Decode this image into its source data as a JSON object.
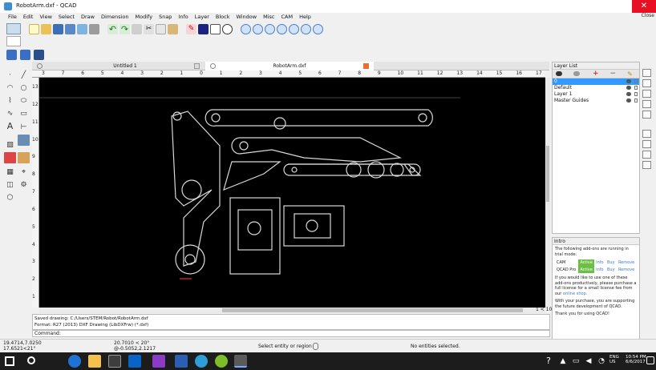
{
  "window": {
    "title": "RobotArm.dxf - QCAD",
    "close_label": "Close"
  },
  "menu": [
    "File",
    "Edit",
    "View",
    "Select",
    "Draw",
    "Dimension",
    "Modify",
    "Snap",
    "Info",
    "Layer",
    "Block",
    "Window",
    "Misc",
    "CAM",
    "Help"
  ],
  "tabs": [
    {
      "label": "Untitled 1"
    },
    {
      "label": "RobotArm.dxf"
    }
  ],
  "ruler_top": [
    "3",
    "7",
    "6",
    "5",
    "4",
    "3",
    "2",
    "1",
    "0",
    "1",
    "2",
    "3",
    "4",
    "5",
    "6",
    "7",
    "8",
    "9",
    "10",
    "11",
    "12",
    "13",
    "14",
    "15",
    "16",
    "17"
  ],
  "ruler_left": [
    "13",
    "12",
    "11",
    "10",
    "9",
    "8",
    "7",
    "6",
    "5",
    "4",
    "3",
    "2",
    "1"
  ],
  "scroll_label": "1 < 10",
  "command_history": [
    "Saved drawing: C:/Users/STEM/Robot/RobotArm.dxf",
    "Format: R27 (2013) DXF Drawing (LibDXFrw) (*.dxf)"
  ],
  "command_prompt": "Command:",
  "layer_panel": {
    "title": "Layer List",
    "layers": [
      {
        "name": "0",
        "selected": true
      },
      {
        "name": "Default",
        "selected": false
      },
      {
        "name": "Layer 1",
        "selected": false
      },
      {
        "name": "Master Guides",
        "selected": false
      }
    ]
  },
  "intro_panel": {
    "title": "Intro",
    "lead": "The following add-ons are running in trial mode:",
    "addons": [
      {
        "name": "CAM",
        "status": "Active",
        "c2": "Info",
        "c3": "Buy",
        "c4": "Remove"
      },
      {
        "name": "QCAD Pro",
        "status": "Active",
        "c2": "Info",
        "c3": "Buy",
        "c4": "Remove"
      }
    ],
    "para1": "If you would like to use one of these add-ons productively, please purchase a full license for a small license fee from our",
    "shop_link": "online shop.",
    "para2": "With your purchase, you are supporting the future development of QCAD.",
    "thanks": "Thank you for using QCAD!"
  },
  "status": {
    "coord_abs": "19.4714,7.0250",
    "coord_abs2": "17.6521<21°",
    "coord_rel": "20.7010 < 20°",
    "coord_rel2": "@-0.5052,2.1217",
    "hint": "Select entity or region",
    "selection": "No entities selected."
  },
  "taskbar": {
    "lang": "ENG",
    "region": "US",
    "time": "10:54 PM",
    "date": "6/6/2017"
  },
  "colors": {
    "canvas": "#000000",
    "accent_active": "#6cbe45",
    "taskbar": "#1c1c1c",
    "close": "#e81123"
  }
}
